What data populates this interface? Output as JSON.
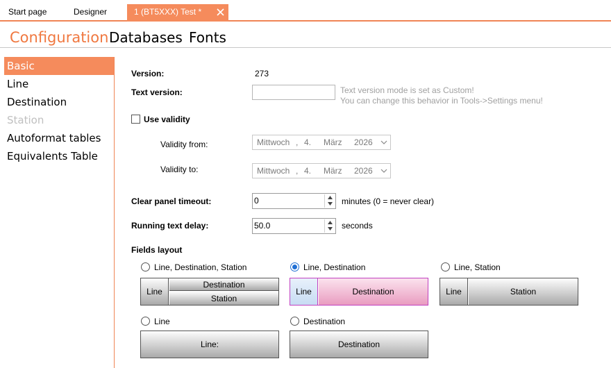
{
  "tabs": [
    {
      "label": "Start page"
    },
    {
      "label": "Designer"
    },
    {
      "label": "1 (BT5XXX) Test *"
    }
  ],
  "sections": [
    "Configuration",
    "Databases",
    "Fonts"
  ],
  "sidebar": {
    "items": [
      {
        "label": "Basic"
      },
      {
        "label": "Line"
      },
      {
        "label": "Destination"
      },
      {
        "label": "Station"
      },
      {
        "label": "Autoformat tables"
      },
      {
        "label": "Equivalents Table"
      }
    ]
  },
  "form": {
    "version_label": "Version:",
    "version_value": "273",
    "text_version_label": "Text version:",
    "text_version_value": "",
    "text_version_hint_1": "Text version mode is set as Custom!",
    "text_version_hint_2": "You can change this behavior in Tools->Settings menu!",
    "use_validity_label": "Use validity",
    "validity_from_label": "Validity from:",
    "validity_to_label": "Validity to:",
    "validity_from": {
      "weekday": "Mittwoch",
      "sep": ",",
      "day": "4.",
      "month": "März",
      "year": "2026"
    },
    "validity_to": {
      "weekday": "Mittwoch",
      "sep": ",",
      "day": "4.",
      "month": "März",
      "year": "2026"
    },
    "clear_panel_label": "Clear panel timeout:",
    "clear_panel_value": "0",
    "clear_panel_unit": "minutes (0 = never clear)",
    "running_text_label": "Running text delay:",
    "running_text_value": "50.0",
    "running_text_unit": "seconds",
    "fields_layout_label": "Fields layout"
  },
  "layouts": {
    "opt1": {
      "label": "Line, Destination, Station",
      "line": "Line",
      "destination": "Destination",
      "station": "Station"
    },
    "opt2": {
      "label": "Line, Destination",
      "line": "Line",
      "destination": "Destination"
    },
    "opt3": {
      "label": "Line, Station",
      "line": "Line",
      "station": "Station"
    },
    "opt4": {
      "label": "Line",
      "line": "Line:"
    },
    "opt5": {
      "label": "Destination",
      "destination": "Destination"
    }
  },
  "colors": {
    "accent": "#f58b5c",
    "radio_selected": "#1f6fd4",
    "selected_preview_border": "#c040c0"
  }
}
